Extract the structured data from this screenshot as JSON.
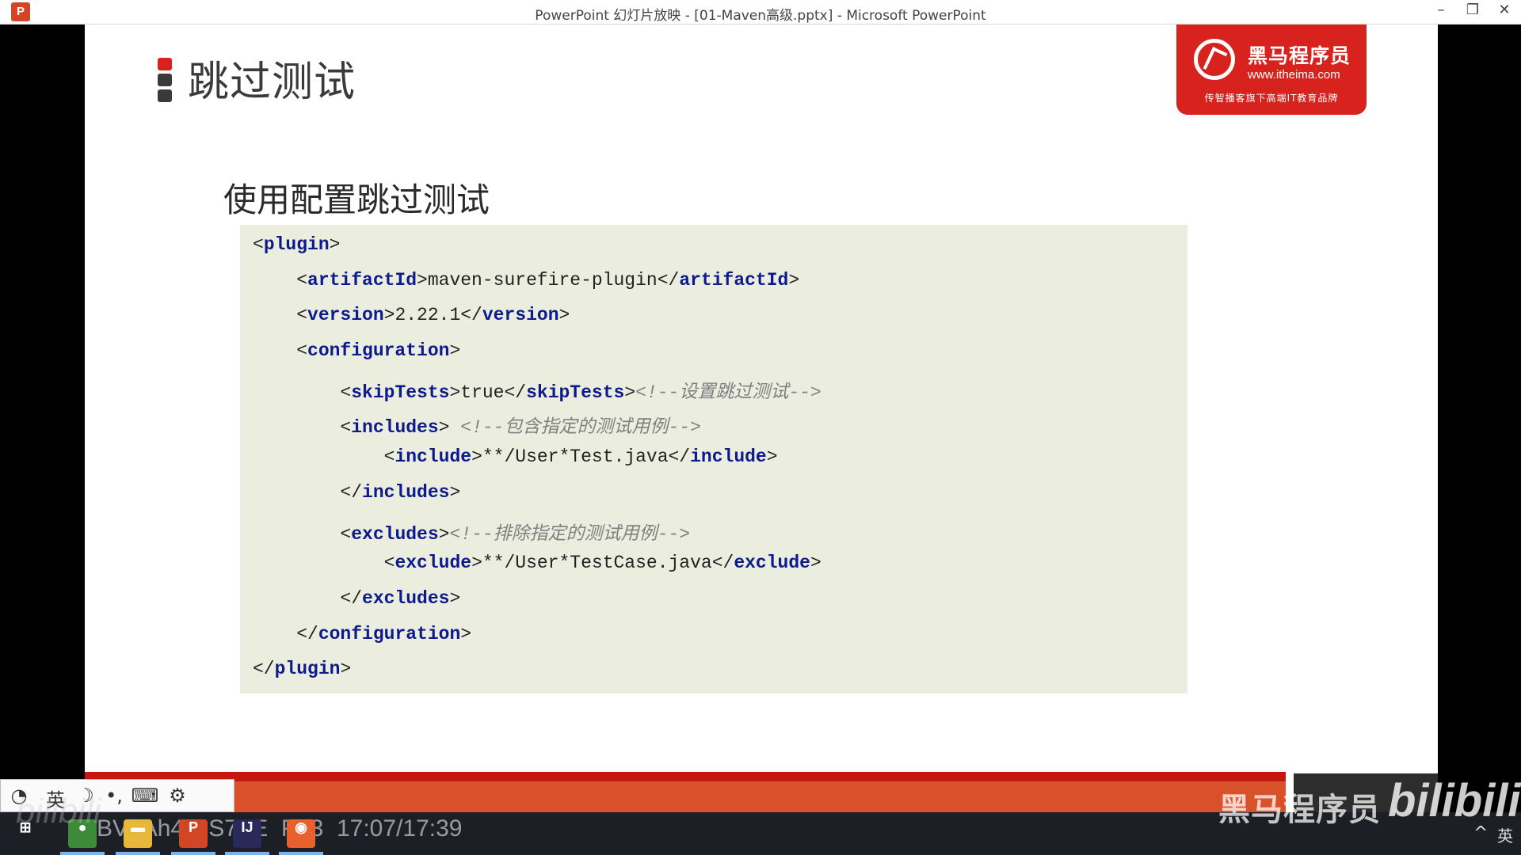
{
  "window": {
    "app_icon": "P",
    "title": "PowerPoint 幻灯片放映 - [01-Maven高级.pptx] - Microsoft PowerPoint",
    "controls": [
      "minimize-icon",
      "restore-icon",
      "close-icon"
    ]
  },
  "slide": {
    "heading": "跳过测试",
    "subheading": "使用配置跳过测试",
    "bullet_colors": [
      "#d7221d",
      "#3a3a3a",
      "#3a3a3a"
    ],
    "logo": {
      "name": "黑马程序员",
      "url": "www.itheima.com",
      "slogan": "传智播客旗下高端IT教育品牌",
      "color": "#d7221d"
    },
    "code_lines": [
      [
        {
          "t": "<"
        },
        {
          "c": "tag",
          "t": "plugin"
        },
        {
          "t": ">"
        }
      ],
      [
        {
          "t": "    <"
        },
        {
          "c": "tag",
          "t": "artifactId"
        },
        {
          "t": ">maven-surefire-plugin</"
        },
        {
          "c": "tag",
          "t": "artifactId"
        },
        {
          "t": ">"
        }
      ],
      [
        {
          "t": "    <"
        },
        {
          "c": "tag",
          "t": "version"
        },
        {
          "t": ">2.22.1</"
        },
        {
          "c": "tag",
          "t": "version"
        },
        {
          "t": ">"
        }
      ],
      [
        {
          "t": "    <"
        },
        {
          "c": "tag",
          "t": "configuration"
        },
        {
          "t": ">"
        }
      ],
      [
        {
          "t": "        <"
        },
        {
          "c": "tag",
          "t": "skipTests"
        },
        {
          "t": ">true</"
        },
        {
          "c": "tag",
          "t": "skipTests"
        },
        {
          "t": ">"
        },
        {
          "c": "comment",
          "t": "<!--设置跳过测试-->"
        }
      ],
      [
        {
          "t": "        <"
        },
        {
          "c": "tag",
          "t": "includes"
        },
        {
          "t": "> "
        },
        {
          "c": "comment",
          "t": "<!--包含指定的测试用例-->"
        }
      ],
      [
        {
          "t": "            <"
        },
        {
          "c": "tag",
          "t": "include"
        },
        {
          "t": ">**/User*Test.java</"
        },
        {
          "c": "tag",
          "t": "include"
        },
        {
          "t": ">"
        }
      ],
      [
        {
          "t": "        </"
        },
        {
          "c": "tag",
          "t": "includes"
        },
        {
          "t": ">"
        }
      ],
      [
        {
          "t": "        <"
        },
        {
          "c": "tag",
          "t": "excludes"
        },
        {
          "t": ">"
        },
        {
          "c": "comment",
          "t": "<!--排除指定的测试用例-->"
        }
      ],
      [
        {
          "t": "            <"
        },
        {
          "c": "tag",
          "t": "exclude"
        },
        {
          "t": ">**/User*TestCase.java</"
        },
        {
          "c": "tag",
          "t": "exclude"
        },
        {
          "t": ">"
        }
      ],
      [
        {
          "t": "        </"
        },
        {
          "c": "tag",
          "t": "excludes"
        },
        {
          "t": ">"
        }
      ],
      [
        {
          "t": "    </"
        },
        {
          "c": "tag",
          "t": "configuration"
        },
        {
          "t": ">"
        }
      ],
      [
        {
          "t": "</"
        },
        {
          "c": "tag",
          "t": "plugin"
        },
        {
          "t": ">"
        }
      ]
    ],
    "colors": {
      "code_background": "#ebeddf",
      "tag": "#0c1a8c",
      "comment": "#808080",
      "band": "#d9512b"
    }
  },
  "ime_toolbar": {
    "items": [
      {
        "icon": "ime-logo-icon",
        "label": "◔"
      },
      {
        "icon": "language-icon",
        "label": "英"
      },
      {
        "icon": "moon-icon",
        "label": "☽"
      },
      {
        "icon": "punctuation-icon",
        "label": "•,"
      },
      {
        "icon": "keyboard-icon",
        "label": "⌨"
      },
      {
        "icon": "gear-icon",
        "label": "⚙"
      }
    ]
  },
  "taskbar": {
    "apps": [
      {
        "icon": "windows-start-icon",
        "label": "⊞",
        "color": "#1c1f26"
      },
      {
        "icon": "chrome-icon",
        "label": "●",
        "color": "#3c8a3a"
      },
      {
        "icon": "file-explorer-icon",
        "label": "▬",
        "color": "#e8b83a"
      },
      {
        "icon": "powerpoint-icon",
        "label": "P",
        "color": "#d24625"
      },
      {
        "icon": "intellij-icon",
        "label": "IJ",
        "color": "#2a2a5a"
      },
      {
        "icon": "browser-icon",
        "label": "◉",
        "color": "#e8612c"
      }
    ],
    "video_info": "BV1Ah411S7ZE  P23  17:07/17:39",
    "tray_chevron": "^",
    "input_language": "英"
  },
  "watermarks": {
    "brand": "黑马程序员",
    "bilibili": "bilibili"
  }
}
